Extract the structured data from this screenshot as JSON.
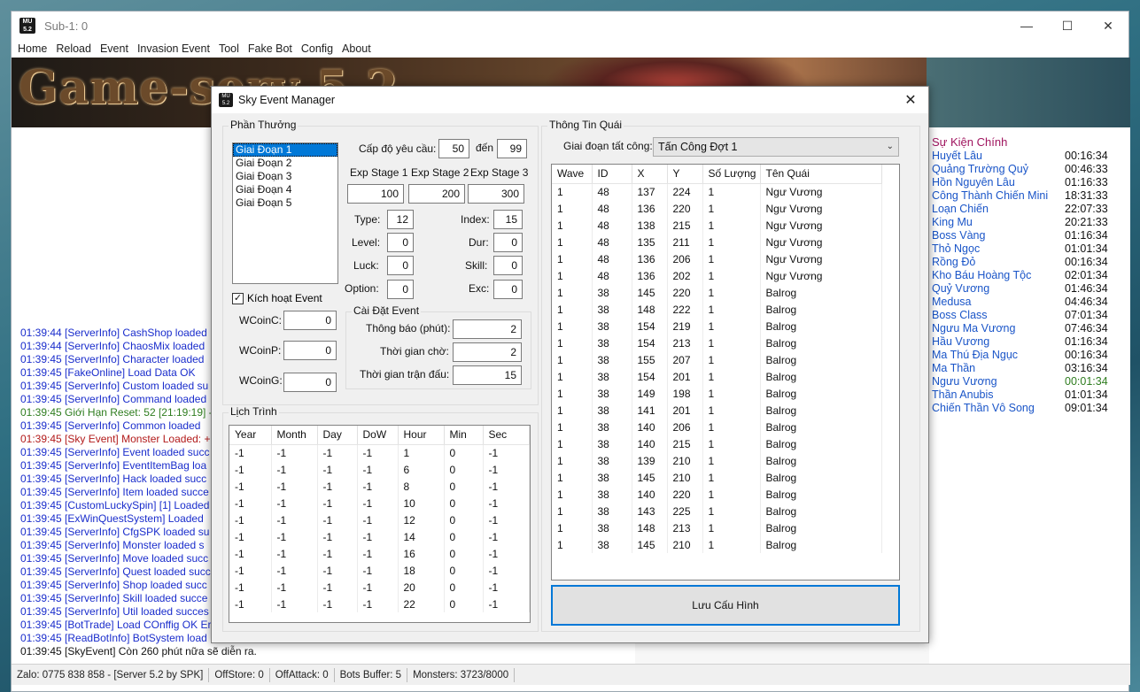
{
  "window": {
    "title": "Sub-1: 0",
    "icon_text": "MU 5.2",
    "controls": [
      "—",
      "☐",
      "✕"
    ]
  },
  "menu": [
    "Home",
    "Reload",
    "Event",
    "Invasion Event",
    "Tool",
    "Fake Bot",
    "Config",
    "About"
  ],
  "banner": {
    "text": "Game-serv 5.2"
  },
  "colors": {
    "info": "#1a2dcc",
    "success": "#2f7d1f",
    "error": "#b21a1a",
    "normal": "#111111",
    "event_name": "#1a55c8",
    "event_title": "#a0155f",
    "accent": "#0078d7"
  },
  "log": [
    {
      "text": "01:39:44 [ServerInfo] CashShop loaded",
      "color": "#1a2dcc"
    },
    {
      "text": "01:39:44 [ServerInfo] ChaosMix loaded",
      "color": "#1a2dcc"
    },
    {
      "text": "01:39:45 [ServerInfo] Character loaded",
      "color": "#1a2dcc"
    },
    {
      "text": "01:39:45 [FakeOnline] Load Data OK",
      "color": "#1a2dcc"
    },
    {
      "text": "01:39:45 [ServerInfo] Custom loaded su",
      "color": "#1a2dcc"
    },
    {
      "text": "01:39:45 [ServerInfo] Command loaded",
      "color": "#1a2dcc"
    },
    {
      "text": "01:39:45 Giới Hạn Reset: 52 [21:19:19] -",
      "color": "#2f7d1f"
    },
    {
      "text": "01:39:45 [ServerInfo] Common loaded",
      "color": "#1a2dcc"
    },
    {
      "text": "01:39:45 [Sky Event] Monster Loaded: +",
      "color": "#b21a1a"
    },
    {
      "text": "01:39:45 [ServerInfo] Event loaded succ",
      "color": "#1a2dcc"
    },
    {
      "text": "01:39:45 [ServerInfo] EventItemBag loa",
      "color": "#1a2dcc"
    },
    {
      "text": "01:39:45 [ServerInfo] Hack loaded succ",
      "color": "#1a2dcc"
    },
    {
      "text": "01:39:45 [ServerInfo] Item loaded succe",
      "color": "#1a2dcc"
    },
    {
      "text": "01:39:45 [CustomLuckySpin] [1] Loaded",
      "color": "#1a2dcc"
    },
    {
      "text": "01:39:45 [ExWinQuestSystem] Loaded",
      "color": "#1a2dcc"
    },
    {
      "text": "01:39:45 [ServerInfo] CfgSPK loaded su",
      "color": "#1a2dcc"
    },
    {
      "text": "01:39:45 [ServerInfo] Monster loaded s",
      "color": "#1a2dcc"
    },
    {
      "text": "01:39:45 [ServerInfo] Move loaded succ",
      "color": "#1a2dcc"
    },
    {
      "text": "01:39:45 [ServerInfo] Quest loaded succ",
      "color": "#1a2dcc"
    },
    {
      "text": "01:39:45 [ServerInfo] Shop loaded succ",
      "color": "#1a2dcc"
    },
    {
      "text": "01:39:45 [ServerInfo] Skill loaded succe",
      "color": "#1a2dcc"
    },
    {
      "text": "01:39:45 [ServerInfo] Util loaded succes",
      "color": "#1a2dcc"
    },
    {
      "text": "01:39:45 [BotTrade] Load COnffig OK Er",
      "color": "#1a2dcc"
    },
    {
      "text": "01:39:45 [ReadBotInfo] BotSystem load",
      "color": "#1a2dcc"
    },
    {
      "text": "01:39:45 [SkyEvent] Còn 260 phút nữa sẽ diễn ra.",
      "color": "#111111"
    }
  ],
  "events_panel": {
    "title": "Sự Kiện Chính",
    "items": [
      {
        "name": "Huyết Lâu",
        "time": "00:16:34",
        "time_color": "#111111"
      },
      {
        "name": "Quảng Trường Quỷ",
        "time": "00:46:33",
        "time_color": "#111111"
      },
      {
        "name": "Hồn Nguyên Lâu",
        "time": "01:16:33",
        "time_color": "#111111"
      },
      {
        "name": "Công Thành Chiến Mini",
        "time": "18:31:33",
        "time_color": "#111111"
      },
      {
        "name": "Loạn Chiến",
        "time": "22:07:33",
        "time_color": "#111111"
      },
      {
        "name": "King Mu",
        "time": "20:21:33",
        "time_color": "#111111"
      },
      {
        "name": "Boss Vàng",
        "time": "01:16:34",
        "time_color": "#111111"
      },
      {
        "name": "Thỏ Ngọc",
        "time": "01:01:34",
        "time_color": "#111111"
      },
      {
        "name": "Rồng Đỏ",
        "time": "00:16:34",
        "time_color": "#111111"
      },
      {
        "name": "Kho Báu Hoàng Tộc",
        "time": "02:01:34",
        "time_color": "#111111"
      },
      {
        "name": "Quỷ Vương",
        "time": "01:46:34",
        "time_color": "#111111"
      },
      {
        "name": "Medusa",
        "time": "04:46:34",
        "time_color": "#111111"
      },
      {
        "name": "Boss Class",
        "time": "07:01:34",
        "time_color": "#111111"
      },
      {
        "name": "Ngưu Ma Vương",
        "time": "07:46:34",
        "time_color": "#111111"
      },
      {
        "name": "Hầu Vương",
        "time": "01:16:34",
        "time_color": "#111111"
      },
      {
        "name": "Ma Thú Địa Ngục",
        "time": "00:16:34",
        "time_color": "#111111"
      },
      {
        "name": "Ma Thần",
        "time": "03:16:34",
        "time_color": "#111111"
      },
      {
        "name": "Ngưu Vương",
        "time": "00:01:34",
        "time_color": "#2f7d1f"
      },
      {
        "name": "Thần Anubis",
        "time": "01:01:34",
        "time_color": "#111111"
      },
      {
        "name": "Chiến Thần Vô Song",
        "time": "09:01:34",
        "time_color": "#111111"
      }
    ]
  },
  "statusbar": [
    "Zalo: 0775 838 858 - [Server 5.2 by SPK]",
    "OffStore: 0",
    "OffAttack: 0",
    "Bots Buffer: 5",
    "Monsters: 3723/8000"
  ],
  "dialog": {
    "title": "Sky Event Manager",
    "icon_text": "MU 5.2",
    "close": "✕",
    "reward": {
      "group_label": "Phần Thưởng",
      "stages": [
        "Giai Đoạn 1",
        "Giai Đoạn 2",
        "Giai Đoạn 3",
        "Giai Đoạn 4",
        "Giai Đoạn 5"
      ],
      "selected_index": 0,
      "level_req_label": "Cấp độ yêu cầu:",
      "level_from": "50",
      "to_label": "đến",
      "level_to": "99",
      "exp_labels": [
        "Exp Stage 1",
        "Exp Stage 2",
        "Exp Stage 3"
      ],
      "exp_values": [
        "100",
        "200",
        "300"
      ],
      "type_label": "Type:",
      "type_value": "12",
      "index_label": "Index:",
      "index_value": "15",
      "level_label": "Level:",
      "level_value": "0",
      "dur_label": "Dur:",
      "dur_value": "0",
      "luck_label": "Luck:",
      "luck_value": "0",
      "skill_label": "Skill:",
      "skill_value": "0",
      "option_label": "Option:",
      "option_value": "0",
      "exc_label": "Exc:",
      "exc_value": "0",
      "activate_label": "Kích hoạt Event",
      "activate_check": "✓",
      "wcoinc_label": "WCoinC:",
      "wcoinc_value": "0",
      "wcoinp_label": "WCoinP:",
      "wcoinp_value": "0",
      "wcoing_label": "WCoinG:",
      "wcoing_value": "0",
      "settings": {
        "group_label": "Cài Đặt Event",
        "notify_label": "Thông báo (phút):",
        "notify_value": "2",
        "wait_label": "Thời gian chờ:",
        "wait_value": "2",
        "battle_label": "Thời gian trận đấu:",
        "battle_value": "15"
      }
    },
    "schedule": {
      "group_label": "Lịch Trình",
      "columns": [
        "Year",
        "Month",
        "Day",
        "DoW",
        "Hour",
        "Min",
        "Sec"
      ],
      "rows": [
        [
          "-1",
          "-1",
          "-1",
          "-1",
          "1",
          "0",
          "-1"
        ],
        [
          "-1",
          "-1",
          "-1",
          "-1",
          "6",
          "0",
          "-1"
        ],
        [
          "-1",
          "-1",
          "-1",
          "-1",
          "8",
          "0",
          "-1"
        ],
        [
          "-1",
          "-1",
          "-1",
          "-1",
          "10",
          "0",
          "-1"
        ],
        [
          "-1",
          "-1",
          "-1",
          "-1",
          "12",
          "0",
          "-1"
        ],
        [
          "-1",
          "-1",
          "-1",
          "-1",
          "14",
          "0",
          "-1"
        ],
        [
          "-1",
          "-1",
          "-1",
          "-1",
          "16",
          "0",
          "-1"
        ],
        [
          "-1",
          "-1",
          "-1",
          "-1",
          "18",
          "0",
          "-1"
        ],
        [
          "-1",
          "-1",
          "-1",
          "-1",
          "20",
          "0",
          "-1"
        ],
        [
          "-1",
          "-1",
          "-1",
          "-1",
          "22",
          "0",
          "-1"
        ]
      ]
    },
    "monster": {
      "group_label": "Thông Tin Quái",
      "phase_label": "Giai đoạn tất công:",
      "phase_value": "Tấn Công Đợt 1",
      "dropdown_arrow": "⌄",
      "columns": [
        "Wave",
        "ID",
        "X",
        "Y",
        "Số Lượng",
        "Tên Quái"
      ],
      "rows": [
        [
          "1",
          "48",
          "137",
          "224",
          "1",
          "Ngư Vương"
        ],
        [
          "1",
          "48",
          "136",
          "220",
          "1",
          "Ngư Vương"
        ],
        [
          "1",
          "48",
          "138",
          "215",
          "1",
          "Ngư Vương"
        ],
        [
          "1",
          "48",
          "135",
          "211",
          "1",
          "Ngư Vương"
        ],
        [
          "1",
          "48",
          "136",
          "206",
          "1",
          "Ngư Vương"
        ],
        [
          "1",
          "48",
          "136",
          "202",
          "1",
          "Ngư Vương"
        ],
        [
          "1",
          "38",
          "145",
          "220",
          "1",
          "Balrog"
        ],
        [
          "1",
          "38",
          "148",
          "222",
          "1",
          "Balrog"
        ],
        [
          "1",
          "38",
          "154",
          "219",
          "1",
          "Balrog"
        ],
        [
          "1",
          "38",
          "154",
          "213",
          "1",
          "Balrog"
        ],
        [
          "1",
          "38",
          "155",
          "207",
          "1",
          "Balrog"
        ],
        [
          "1",
          "38",
          "154",
          "201",
          "1",
          "Balrog"
        ],
        [
          "1",
          "38",
          "149",
          "198",
          "1",
          "Balrog"
        ],
        [
          "1",
          "38",
          "141",
          "201",
          "1",
          "Balrog"
        ],
        [
          "1",
          "38",
          "140",
          "206",
          "1",
          "Balrog"
        ],
        [
          "1",
          "38",
          "140",
          "215",
          "1",
          "Balrog"
        ],
        [
          "1",
          "38",
          "139",
          "210",
          "1",
          "Balrog"
        ],
        [
          "1",
          "38",
          "145",
          "210",
          "1",
          "Balrog"
        ],
        [
          "1",
          "38",
          "140",
          "220",
          "1",
          "Balrog"
        ],
        [
          "1",
          "38",
          "143",
          "225",
          "1",
          "Balrog"
        ],
        [
          "1",
          "38",
          "148",
          "213",
          "1",
          "Balrog"
        ],
        [
          "1",
          "38",
          "145",
          "210",
          "1",
          "Balrog"
        ]
      ]
    },
    "save_label": "Lưu Cấu Hình"
  }
}
